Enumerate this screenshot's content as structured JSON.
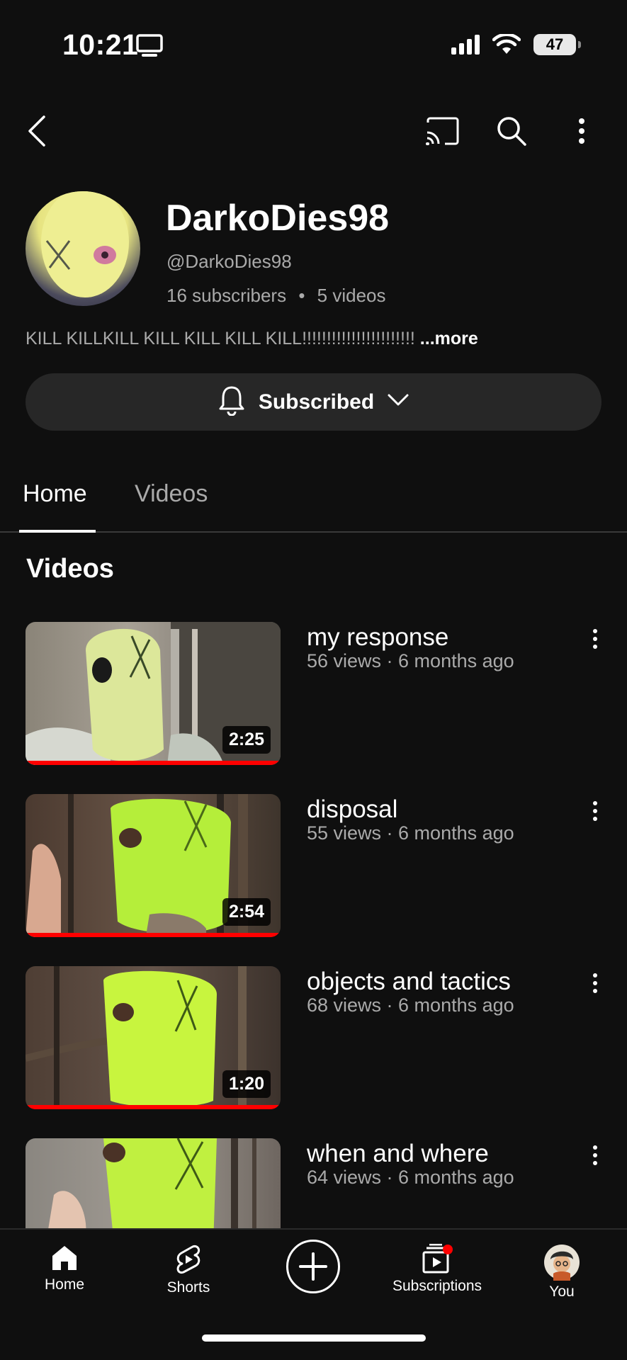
{
  "status_bar": {
    "time": "10:21",
    "battery": "47"
  },
  "channel": {
    "name": "DarkoDies98",
    "handle": "@DarkoDies98",
    "subscribers": "16 subscribers",
    "separator": "•",
    "videos_count": "5 videos",
    "description": "KILL KILLKILL KILL KILL KILL KILL!!!!!!!!!!!!!!!!!!!!!!!",
    "more_label": "...more",
    "subscribe_label": "Subscribed"
  },
  "tabs": [
    {
      "label": "Home",
      "active": true
    },
    {
      "label": "Videos",
      "active": false
    }
  ],
  "section_title": "Videos",
  "videos": [
    {
      "title": "my response",
      "meta": "56 views · 6 months ago",
      "duration": "2:25"
    },
    {
      "title": "disposal",
      "meta": "55 views · 6 months ago",
      "duration": "2:54"
    },
    {
      "title": "objects and tactics",
      "meta": "68 views · 6 months ago",
      "duration": "1:20"
    },
    {
      "title": "when and where",
      "meta": "64 views · 6 months ago",
      "duration": ""
    }
  ],
  "bottom_nav": {
    "home": "Home",
    "shorts": "Shorts",
    "subscriptions": "Subscriptions",
    "you": "You"
  },
  "colors": {
    "background": "#0f0f0f",
    "progress": "#ff0000",
    "secondary_text": "#aaaaaa",
    "pill": "#272727"
  },
  "icons": [
    "back-arrow-icon",
    "cast-icon",
    "search-icon",
    "more-vert-icon",
    "bell-icon",
    "chevron-down-icon",
    "home-icon",
    "shorts-icon",
    "create-icon",
    "subscriptions-icon"
  ]
}
